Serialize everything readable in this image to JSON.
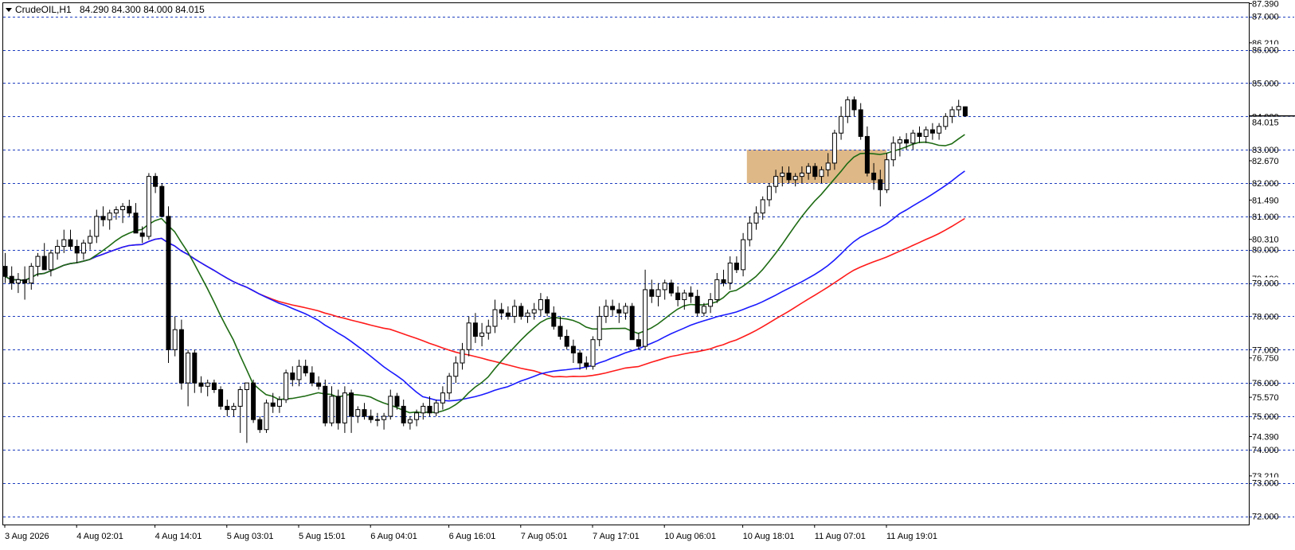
{
  "header": {
    "symbol": "CrudeOIL,H1",
    "ohlc": "84.290 84.300 84.000 84.015"
  },
  "colors": {
    "background": "#ffffff",
    "grid_level": "#1f3fbf",
    "bull_candle": "#ffffff",
    "bear_candle": "#000000",
    "ma_fast": "#1e6b14",
    "ma_mid": "#1a1aff",
    "ma_slow": "#ff1a1a",
    "zone": "#deb887",
    "axis_text": "#000000"
  },
  "chart_data": {
    "type": "candlestick",
    "title": "CrudeOIL,H1",
    "price_axis": {
      "ylim": [
        71.75,
        87.4
      ],
      "level_lines": [
        "72.000",
        "73.000",
        "74.000",
        "75.000",
        "76.000",
        "77.000",
        "78.000",
        "79.000",
        "80.000",
        "81.000",
        "82.000",
        "83.000",
        "84.000",
        "85.000",
        "86.000",
        "87.000"
      ],
      "tick_labels": [
        "87.390",
        "86.210",
        "82.670",
        "81.490",
        "80.310",
        "79.130",
        "76.750",
        "75.570",
        "74.390",
        "73.210"
      ],
      "current_price": "84.015"
    },
    "time_axis": {
      "tick_labels": [
        "3 Aug 2026",
        "4 Aug 02:01",
        "4 Aug 14:01",
        "5 Aug 03:01",
        "5 Aug 15:01",
        "6 Aug 04:01",
        "6 Aug 16:01",
        "7 Aug 05:01",
        "7 Aug 17:01",
        "10 Aug 06:01",
        "10 Aug 18:01",
        "11 Aug 07:01",
        "11 Aug 19:01"
      ]
    },
    "zone": {
      "from_bar": 114,
      "to_bar": 135,
      "low": 82.0,
      "high": 83.0,
      "label": ""
    },
    "candles": [
      {
        "o": 79.5,
        "h": 79.9,
        "l": 79.0,
        "c": 79.2
      },
      {
        "o": 79.2,
        "h": 79.5,
        "l": 78.8,
        "c": 79.0
      },
      {
        "o": 79.0,
        "h": 79.3,
        "l": 78.7,
        "c": 79.1
      },
      {
        "o": 79.1,
        "h": 79.5,
        "l": 78.5,
        "c": 79.0
      },
      {
        "o": 79.0,
        "h": 79.6,
        "l": 78.8,
        "c": 79.5
      },
      {
        "o": 79.5,
        "h": 79.9,
        "l": 79.2,
        "c": 79.8
      },
      {
        "o": 79.8,
        "h": 80.2,
        "l": 79.5,
        "c": 79.4
      },
      {
        "o": 79.4,
        "h": 80.0,
        "l": 79.2,
        "c": 79.9
      },
      {
        "o": 79.9,
        "h": 80.3,
        "l": 79.7,
        "c": 80.1
      },
      {
        "o": 80.1,
        "h": 80.6,
        "l": 79.9,
        "c": 80.3
      },
      {
        "o": 80.3,
        "h": 80.6,
        "l": 80.0,
        "c": 80.1
      },
      {
        "o": 80.1,
        "h": 80.3,
        "l": 79.6,
        "c": 79.9
      },
      {
        "o": 79.9,
        "h": 80.3,
        "l": 79.7,
        "c": 80.2
      },
      {
        "o": 80.2,
        "h": 80.6,
        "l": 80.0,
        "c": 80.4
      },
      {
        "o": 80.4,
        "h": 81.2,
        "l": 80.2,
        "c": 81.0
      },
      {
        "o": 81.0,
        "h": 81.3,
        "l": 80.7,
        "c": 80.9
      },
      {
        "o": 80.9,
        "h": 81.2,
        "l": 80.6,
        "c": 81.1
      },
      {
        "o": 81.1,
        "h": 81.3,
        "l": 80.9,
        "c": 81.2
      },
      {
        "o": 81.2,
        "h": 81.4,
        "l": 80.8,
        "c": 81.3
      },
      {
        "o": 81.3,
        "h": 81.5,
        "l": 81.0,
        "c": 81.1
      },
      {
        "o": 81.1,
        "h": 81.4,
        "l": 80.5,
        "c": 80.5
      },
      {
        "o": 80.5,
        "h": 80.7,
        "l": 80.2,
        "c": 80.4
      },
      {
        "o": 80.4,
        "h": 82.3,
        "l": 80.3,
        "c": 82.2
      },
      {
        "o": 82.2,
        "h": 82.3,
        "l": 81.7,
        "c": 81.9
      },
      {
        "o": 81.9,
        "h": 82.0,
        "l": 81.0,
        "c": 81.0
      },
      {
        "o": 81.0,
        "h": 81.3,
        "l": 76.6,
        "c": 77.0
      },
      {
        "o": 77.0,
        "h": 78.0,
        "l": 76.8,
        "c": 77.6
      },
      {
        "o": 77.6,
        "h": 77.9,
        "l": 75.8,
        "c": 76.0
      },
      {
        "o": 76.0,
        "h": 77.0,
        "l": 75.3,
        "c": 76.9
      },
      {
        "o": 76.9,
        "h": 77.0,
        "l": 75.7,
        "c": 76.0
      },
      {
        "o": 76.0,
        "h": 76.2,
        "l": 75.7,
        "c": 75.9
      },
      {
        "o": 75.9,
        "h": 76.1,
        "l": 75.6,
        "c": 76.0
      },
      {
        "o": 76.0,
        "h": 76.1,
        "l": 75.7,
        "c": 75.8
      },
      {
        "o": 75.8,
        "h": 75.9,
        "l": 75.2,
        "c": 75.3
      },
      {
        "o": 75.3,
        "h": 75.5,
        "l": 75.0,
        "c": 75.2
      },
      {
        "o": 75.2,
        "h": 75.4,
        "l": 75.0,
        "c": 75.3
      },
      {
        "o": 75.3,
        "h": 75.9,
        "l": 74.5,
        "c": 75.8
      },
      {
        "o": 75.8,
        "h": 76.0,
        "l": 74.2,
        "c": 76.0
      },
      {
        "o": 76.0,
        "h": 76.1,
        "l": 74.8,
        "c": 74.9
      },
      {
        "o": 74.9,
        "h": 75.0,
        "l": 74.5,
        "c": 74.6
      },
      {
        "o": 74.6,
        "h": 75.5,
        "l": 74.5,
        "c": 75.4
      },
      {
        "o": 75.4,
        "h": 75.7,
        "l": 75.1,
        "c": 75.3
      },
      {
        "o": 75.3,
        "h": 75.6,
        "l": 75.1,
        "c": 75.5
      },
      {
        "o": 75.5,
        "h": 76.4,
        "l": 75.4,
        "c": 76.3
      },
      {
        "o": 76.3,
        "h": 76.5,
        "l": 75.9,
        "c": 76.1
      },
      {
        "o": 76.1,
        "h": 76.7,
        "l": 75.9,
        "c": 76.5
      },
      {
        "o": 76.5,
        "h": 76.7,
        "l": 76.2,
        "c": 76.3
      },
      {
        "o": 76.3,
        "h": 76.5,
        "l": 75.9,
        "c": 76.0
      },
      {
        "o": 76.0,
        "h": 76.2,
        "l": 75.8,
        "c": 75.9
      },
      {
        "o": 75.9,
        "h": 76.1,
        "l": 74.7,
        "c": 74.8
      },
      {
        "o": 74.8,
        "h": 75.9,
        "l": 74.7,
        "c": 75.6
      },
      {
        "o": 75.6,
        "h": 75.8,
        "l": 74.6,
        "c": 74.8
      },
      {
        "o": 74.8,
        "h": 75.9,
        "l": 74.5,
        "c": 75.7
      },
      {
        "o": 75.7,
        "h": 75.8,
        "l": 74.5,
        "c": 75.0
      },
      {
        "o": 75.0,
        "h": 75.3,
        "l": 74.8,
        "c": 75.2
      },
      {
        "o": 75.2,
        "h": 75.4,
        "l": 74.9,
        "c": 75.0
      },
      {
        "o": 75.0,
        "h": 75.2,
        "l": 74.8,
        "c": 74.9
      },
      {
        "o": 74.9,
        "h": 75.1,
        "l": 74.7,
        "c": 74.9
      },
      {
        "o": 74.9,
        "h": 75.1,
        "l": 74.6,
        "c": 75.0
      },
      {
        "o": 75.0,
        "h": 75.8,
        "l": 74.9,
        "c": 75.6
      },
      {
        "o": 75.6,
        "h": 75.7,
        "l": 75.2,
        "c": 75.3
      },
      {
        "o": 75.3,
        "h": 75.5,
        "l": 74.7,
        "c": 74.8
      },
      {
        "o": 74.8,
        "h": 75.0,
        "l": 74.6,
        "c": 74.9
      },
      {
        "o": 74.9,
        "h": 75.2,
        "l": 74.7,
        "c": 75.1
      },
      {
        "o": 75.1,
        "h": 75.4,
        "l": 74.9,
        "c": 75.3
      },
      {
        "o": 75.3,
        "h": 75.6,
        "l": 75.0,
        "c": 75.1
      },
      {
        "o": 75.1,
        "h": 75.5,
        "l": 75.0,
        "c": 75.4
      },
      {
        "o": 75.4,
        "h": 75.9,
        "l": 75.2,
        "c": 75.7
      },
      {
        "o": 75.7,
        "h": 76.3,
        "l": 75.5,
        "c": 76.2
      },
      {
        "o": 76.2,
        "h": 76.8,
        "l": 76.0,
        "c": 76.6
      },
      {
        "o": 76.6,
        "h": 77.2,
        "l": 76.4,
        "c": 77.0
      },
      {
        "o": 77.0,
        "h": 78.0,
        "l": 76.8,
        "c": 77.8
      },
      {
        "o": 77.8,
        "h": 78.1,
        "l": 77.2,
        "c": 77.4
      },
      {
        "o": 77.4,
        "h": 77.8,
        "l": 77.1,
        "c": 77.5
      },
      {
        "o": 77.5,
        "h": 77.9,
        "l": 77.3,
        "c": 77.7
      },
      {
        "o": 77.7,
        "h": 78.5,
        "l": 77.5,
        "c": 78.2
      },
      {
        "o": 78.2,
        "h": 78.4,
        "l": 77.9,
        "c": 78.1
      },
      {
        "o": 78.1,
        "h": 78.3,
        "l": 77.9,
        "c": 78.0
      },
      {
        "o": 78.0,
        "h": 78.5,
        "l": 77.8,
        "c": 78.3
      },
      {
        "o": 78.3,
        "h": 78.4,
        "l": 77.9,
        "c": 78.0
      },
      {
        "o": 78.0,
        "h": 78.2,
        "l": 77.8,
        "c": 78.1
      },
      {
        "o": 78.1,
        "h": 78.4,
        "l": 77.9,
        "c": 78.2
      },
      {
        "o": 78.2,
        "h": 78.7,
        "l": 78.0,
        "c": 78.5
      },
      {
        "o": 78.5,
        "h": 78.6,
        "l": 78.0,
        "c": 78.1
      },
      {
        "o": 78.1,
        "h": 78.3,
        "l": 77.6,
        "c": 77.7
      },
      {
        "o": 77.7,
        "h": 78.0,
        "l": 77.3,
        "c": 77.4
      },
      {
        "o": 77.4,
        "h": 77.6,
        "l": 77.0,
        "c": 77.1
      },
      {
        "o": 77.1,
        "h": 77.3,
        "l": 76.6,
        "c": 76.9
      },
      {
        "o": 76.9,
        "h": 77.0,
        "l": 76.4,
        "c": 76.6
      },
      {
        "o": 76.6,
        "h": 76.8,
        "l": 76.4,
        "c": 76.5
      },
      {
        "o": 76.5,
        "h": 77.4,
        "l": 76.4,
        "c": 77.3
      },
      {
        "o": 77.3,
        "h": 78.3,
        "l": 77.1,
        "c": 78.0
      },
      {
        "o": 78.0,
        "h": 78.5,
        "l": 77.8,
        "c": 78.3
      },
      {
        "o": 78.3,
        "h": 78.5,
        "l": 78.0,
        "c": 78.2
      },
      {
        "o": 78.2,
        "h": 78.4,
        "l": 77.8,
        "c": 78.1
      },
      {
        "o": 78.1,
        "h": 78.4,
        "l": 77.9,
        "c": 78.3
      },
      {
        "o": 78.3,
        "h": 78.4,
        "l": 77.3,
        "c": 77.3
      },
      {
        "o": 77.3,
        "h": 77.5,
        "l": 77.0,
        "c": 77.1
      },
      {
        "o": 77.1,
        "h": 79.4,
        "l": 77.0,
        "c": 78.8
      },
      {
        "o": 78.8,
        "h": 79.1,
        "l": 78.4,
        "c": 78.6
      },
      {
        "o": 78.6,
        "h": 79.0,
        "l": 78.3,
        "c": 78.8
      },
      {
        "o": 78.8,
        "h": 79.1,
        "l": 78.5,
        "c": 79.0
      },
      {
        "o": 79.0,
        "h": 79.1,
        "l": 78.6,
        "c": 78.7
      },
      {
        "o": 78.7,
        "h": 78.9,
        "l": 78.3,
        "c": 78.5
      },
      {
        "o": 78.5,
        "h": 78.8,
        "l": 78.2,
        "c": 78.7
      },
      {
        "o": 78.7,
        "h": 78.9,
        "l": 78.4,
        "c": 78.6
      },
      {
        "o": 78.6,
        "h": 78.8,
        "l": 78.0,
        "c": 78.1
      },
      {
        "o": 78.1,
        "h": 78.4,
        "l": 78.0,
        "c": 78.3
      },
      {
        "o": 78.3,
        "h": 78.7,
        "l": 78.1,
        "c": 78.5
      },
      {
        "o": 78.5,
        "h": 79.3,
        "l": 78.4,
        "c": 79.1
      },
      {
        "o": 79.1,
        "h": 79.4,
        "l": 78.9,
        "c": 79.0
      },
      {
        "o": 79.0,
        "h": 79.8,
        "l": 78.8,
        "c": 79.6
      },
      {
        "o": 79.6,
        "h": 79.8,
        "l": 79.3,
        "c": 79.4
      },
      {
        "o": 79.4,
        "h": 80.5,
        "l": 79.2,
        "c": 80.3
      },
      {
        "o": 80.3,
        "h": 81.0,
        "l": 80.1,
        "c": 80.8
      },
      {
        "o": 80.8,
        "h": 81.3,
        "l": 80.6,
        "c": 81.1
      },
      {
        "o": 81.1,
        "h": 81.6,
        "l": 80.9,
        "c": 81.5
      },
      {
        "o": 81.5,
        "h": 82.0,
        "l": 81.3,
        "c": 81.9
      },
      {
        "o": 81.9,
        "h": 82.4,
        "l": 81.7,
        "c": 82.2
      },
      {
        "o": 82.2,
        "h": 82.5,
        "l": 81.9,
        "c": 82.3
      },
      {
        "o": 82.3,
        "h": 82.5,
        "l": 82.0,
        "c": 82.1
      },
      {
        "o": 82.1,
        "h": 82.3,
        "l": 81.9,
        "c": 82.2
      },
      {
        "o": 82.2,
        "h": 82.5,
        "l": 82.0,
        "c": 82.3
      },
      {
        "o": 82.3,
        "h": 82.6,
        "l": 82.1,
        "c": 82.5
      },
      {
        "o": 82.5,
        "h": 82.6,
        "l": 82.1,
        "c": 82.2
      },
      {
        "o": 82.2,
        "h": 82.5,
        "l": 82.0,
        "c": 82.4
      },
      {
        "o": 82.4,
        "h": 82.9,
        "l": 82.2,
        "c": 82.6
      },
      {
        "o": 82.6,
        "h": 83.6,
        "l": 82.4,
        "c": 83.5
      },
      {
        "o": 83.5,
        "h": 84.3,
        "l": 83.3,
        "c": 84.0
      },
      {
        "o": 84.0,
        "h": 84.6,
        "l": 83.8,
        "c": 84.5
      },
      {
        "o": 84.5,
        "h": 84.6,
        "l": 84.0,
        "c": 84.2
      },
      {
        "o": 84.2,
        "h": 84.4,
        "l": 83.3,
        "c": 83.4
      },
      {
        "o": 83.4,
        "h": 83.7,
        "l": 82.2,
        "c": 82.3
      },
      {
        "o": 82.3,
        "h": 82.6,
        "l": 81.8,
        "c": 82.1
      },
      {
        "o": 82.1,
        "h": 82.4,
        "l": 81.3,
        "c": 81.8
      },
      {
        "o": 81.8,
        "h": 82.9,
        "l": 81.7,
        "c": 82.7
      },
      {
        "o": 82.7,
        "h": 83.4,
        "l": 82.5,
        "c": 83.2
      },
      {
        "o": 83.2,
        "h": 83.4,
        "l": 82.8,
        "c": 83.3
      },
      {
        "o": 83.3,
        "h": 83.5,
        "l": 83.0,
        "c": 83.2
      },
      {
        "o": 83.2,
        "h": 83.6,
        "l": 83.0,
        "c": 83.5
      },
      {
        "o": 83.5,
        "h": 83.7,
        "l": 83.2,
        "c": 83.4
      },
      {
        "o": 83.4,
        "h": 83.7,
        "l": 83.2,
        "c": 83.6
      },
      {
        "o": 83.6,
        "h": 83.8,
        "l": 83.3,
        "c": 83.5
      },
      {
        "o": 83.5,
        "h": 83.8,
        "l": 83.3,
        "c": 83.7
      },
      {
        "o": 83.7,
        "h": 84.1,
        "l": 83.6,
        "c": 84.0
      },
      {
        "o": 84.0,
        "h": 84.3,
        "l": 83.8,
        "c": 84.2
      },
      {
        "o": 84.2,
        "h": 84.5,
        "l": 84.0,
        "c": 84.3
      },
      {
        "o": 84.29,
        "h": 84.3,
        "l": 84.0,
        "c": 84.015
      }
    ]
  }
}
